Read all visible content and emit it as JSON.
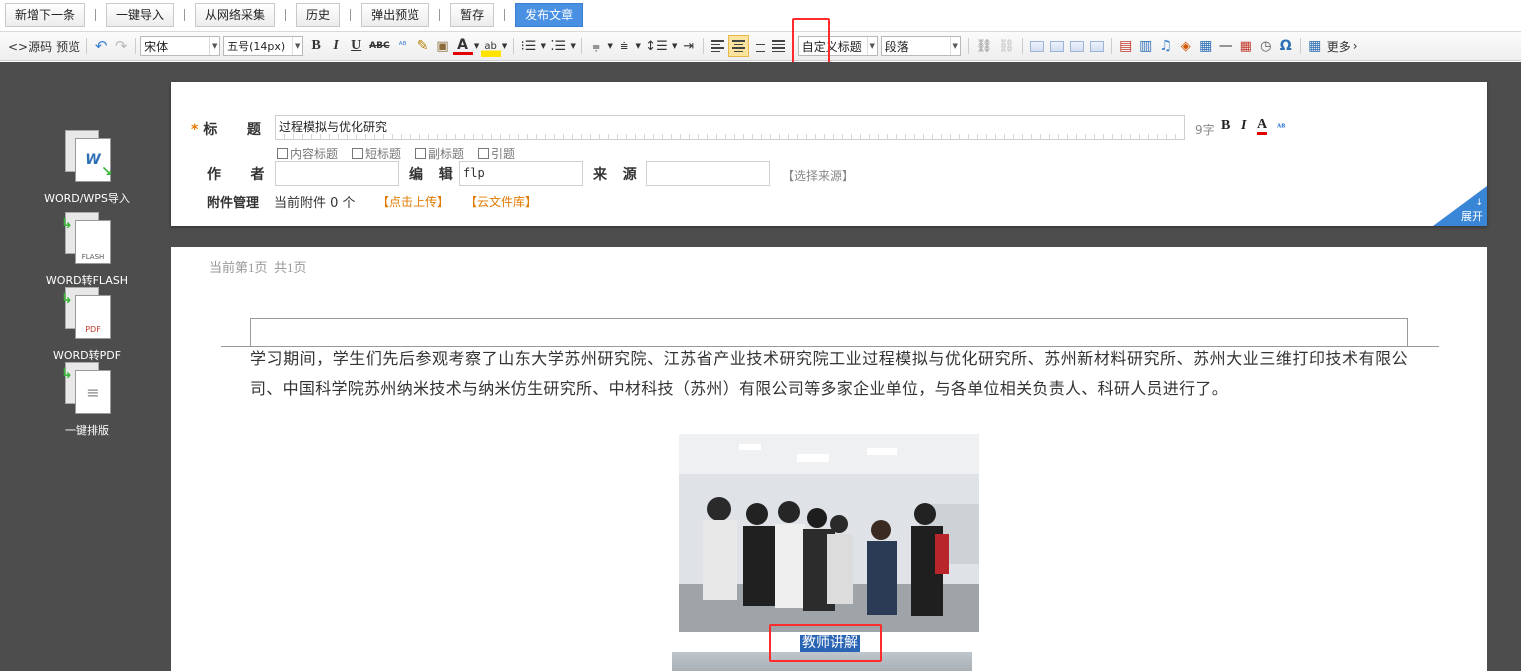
{
  "topbar": {
    "buttons": [
      "新增下一条",
      "一键导入",
      "从网络采集",
      "历史",
      "弹出预览",
      "暂存",
      "发布文章"
    ]
  },
  "editor_toolbar": {
    "source_label": "<>源码",
    "preview_label": "预览",
    "font_family": "宋体",
    "font_size": "五号(14px)",
    "heading_select": "自定义标题",
    "paragraph_select": "段落",
    "more_label": "更多",
    "active_tool": "align-center"
  },
  "left_tools": [
    {
      "label": "WORD/WPS导入",
      "icon_text": "W"
    },
    {
      "label": "WORD转FLASH",
      "icon_text": "FLASH"
    },
    {
      "label": "WORD转PDF",
      "icon_text": "PDF"
    },
    {
      "label": "一键排版",
      "icon_text": "≡"
    }
  ],
  "meta": {
    "title_label": "标    题",
    "title_value": "过程模拟与优化研究",
    "word_count": "9字",
    "checkboxes": [
      "内容标题",
      "短标题",
      "副标题",
      "引题"
    ],
    "author_label": "作    者",
    "author_value": "",
    "editor_label": "编  辑",
    "editor_value": "flp",
    "source_label": "来  源",
    "source_value": "",
    "choose_source": "【选择来源】",
    "attach_label": "附件管理",
    "attach_count": "当前附件 0 个",
    "upload_link": "【点击上传】",
    "cloud_link": "【云文件库】",
    "expand_label": "展开"
  },
  "document": {
    "page_info": "当前第1页  共1页",
    "paragraph": "学习期间，学生们先后参观考察了山东大学苏州研究院、江苏省产业技术研究院工业过程模拟与优化研究所、苏州新材料研究所、苏州大业三维打印技术有限公司、中国科学院苏州纳米技术与纳米仿生研究所、中材科技（苏州）有限公司等多家企业单位，与各单位相关负责人、科研人员进行了。",
    "caption": "教师讲解"
  },
  "colors": {
    "accent": "#4a90e2",
    "highlight": "#ff2b2b",
    "link_orange": "#e07a00",
    "workspace": "#4d4d4d"
  }
}
